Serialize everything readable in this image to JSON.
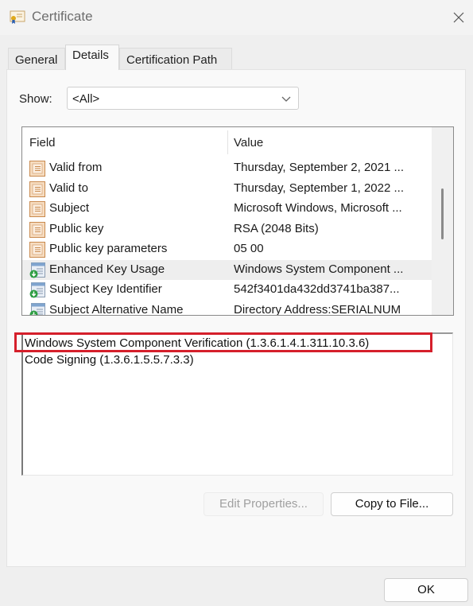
{
  "window": {
    "title": "Certificate",
    "icon": "certificate-icon",
    "close_icon": "close-icon"
  },
  "tabs": [
    {
      "label": "General",
      "active": false
    },
    {
      "label": "Details",
      "active": true
    },
    {
      "label": "Certification Path",
      "active": false
    }
  ],
  "show": {
    "label": "Show:",
    "selected": "<All>",
    "icon": "chevron-down-icon"
  },
  "fields_list": {
    "columns": [
      "Field",
      "Value"
    ],
    "rows": [
      {
        "field": "Valid from",
        "value": "Thursday, September 2, 2021 ...",
        "icon": "property-icon"
      },
      {
        "field": "Valid to",
        "value": "Thursday, September 1, 2022 ...",
        "icon": "property-icon"
      },
      {
        "field": "Subject",
        "value": "Microsoft Windows, Microsoft ...",
        "icon": "property-icon"
      },
      {
        "field": "Public key",
        "value": "RSA (2048 Bits)",
        "icon": "property-icon"
      },
      {
        "field": "Public key parameters",
        "value": "05 00",
        "icon": "property-icon"
      },
      {
        "field": "Enhanced Key Usage",
        "value": "Windows System Component ...",
        "icon": "extension-icon",
        "selected": true
      },
      {
        "field": "Subject Key Identifier",
        "value": "542f3401da432dd3741ba387...",
        "icon": "extension-icon"
      },
      {
        "field": "Subject Alternative Name",
        "value": "Directory Address:SERIALNUM",
        "icon": "extension-icon"
      }
    ]
  },
  "detail": {
    "lines": [
      "Windows System Component Verification (1.3.6.1.4.1.311.10.3.6)",
      "Code Signing (1.3.6.1.5.5.7.3.3)"
    ],
    "highlight_color": "#d51f2b"
  },
  "buttons": {
    "edit_properties": "Edit Properties...",
    "copy_to_file": "Copy to File...",
    "ok": "OK"
  }
}
